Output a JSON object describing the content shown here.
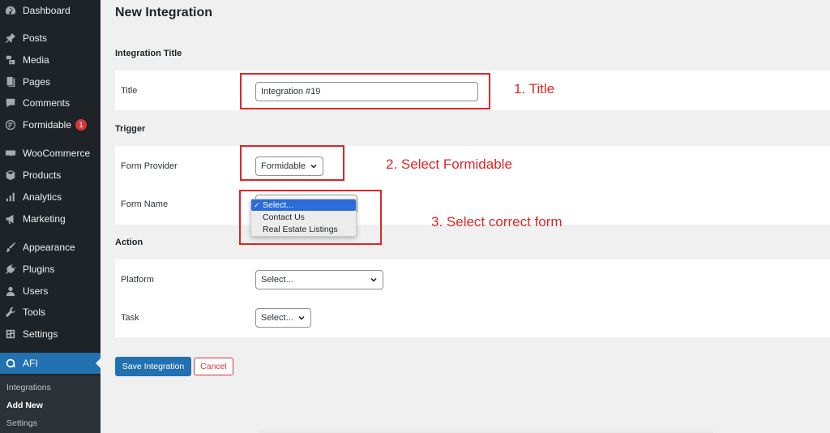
{
  "sidebar": {
    "items": [
      {
        "label": "Dashboard",
        "icon": "dashboard-icon"
      },
      {
        "label": "Posts",
        "icon": "pin-icon"
      },
      {
        "label": "Media",
        "icon": "media-icon"
      },
      {
        "label": "Pages",
        "icon": "pages-icon"
      },
      {
        "label": "Comments",
        "icon": "comment-icon"
      },
      {
        "label": "Formidable",
        "icon": "formidable-icon",
        "badge": "1"
      },
      {
        "label": "WooCommerce",
        "icon": "woo-icon"
      },
      {
        "label": "Products",
        "icon": "box-icon"
      },
      {
        "label": "Analytics",
        "icon": "bar-chart-icon"
      },
      {
        "label": "Marketing",
        "icon": "megaphone-icon"
      },
      {
        "label": "Appearance",
        "icon": "brush-icon"
      },
      {
        "label": "Plugins",
        "icon": "plug-icon"
      },
      {
        "label": "Users",
        "icon": "user-icon"
      },
      {
        "label": "Tools",
        "icon": "wrench-icon"
      },
      {
        "label": "Settings",
        "icon": "settings-icon"
      },
      {
        "label": "AFI",
        "icon": "afi-icon"
      }
    ],
    "submenu": [
      "Integrations",
      "Add New",
      "Settings"
    ]
  },
  "page": {
    "title": "New Integration",
    "sections": {
      "integration_title": "Integration Title",
      "trigger": "Trigger",
      "action": "Action"
    },
    "fields": {
      "title_label": "Title",
      "title_value": "Integration #19",
      "form_provider_label": "Form Provider",
      "form_provider_value": "Formidable",
      "form_name_label": "Form Name",
      "platform_label": "Platform",
      "platform_value": "Select...",
      "task_label": "Task",
      "task_value": "Select..."
    },
    "dropdown": {
      "options": [
        "Select...",
        "Contact Us",
        "Real Estate Listings"
      ],
      "check": "✓"
    },
    "buttons": {
      "save": "Save Integration",
      "cancel": "Cancel"
    }
  },
  "annotations": {
    "step1": "1. Title",
    "step2": "2. Select Formidable",
    "step3": "3. Select correct form"
  },
  "colors": {
    "accent": "#2271b1",
    "annotation_red": "#e02525",
    "sidebar_bg": "#1d2327"
  }
}
